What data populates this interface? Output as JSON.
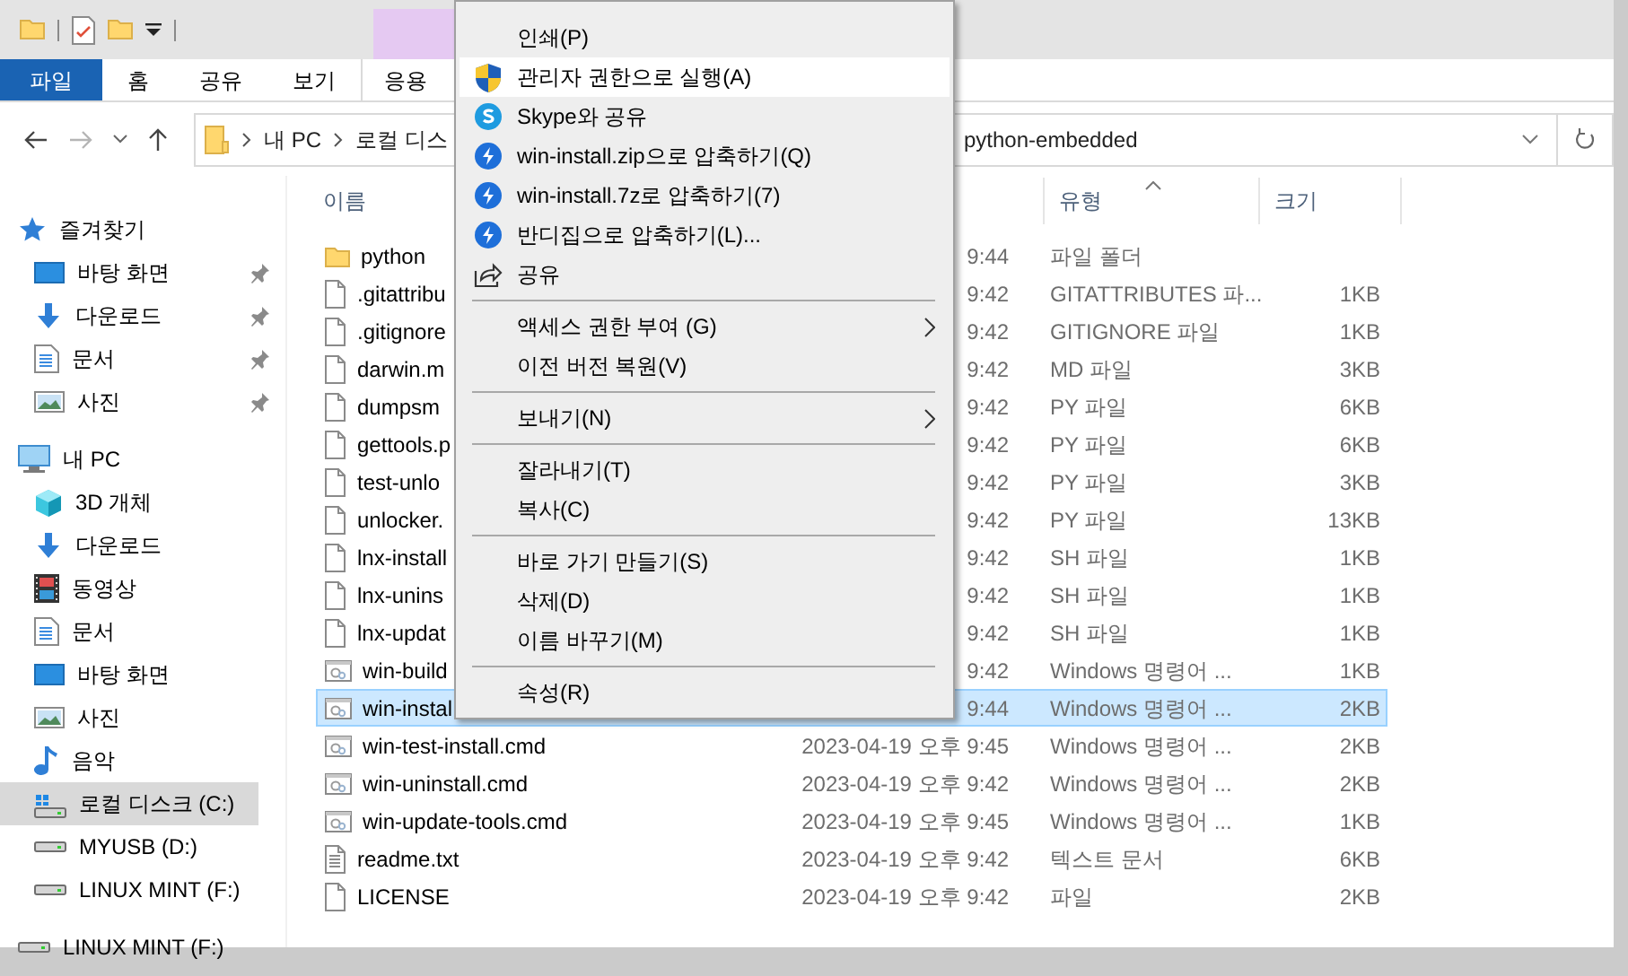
{
  "ribbon": {
    "tabs": [
      {
        "label": "파일",
        "kind": "file_menu"
      },
      {
        "label": "홈",
        "kind": "tab"
      },
      {
        "label": "공유",
        "kind": "tab"
      },
      {
        "label": "보기",
        "kind": "tab"
      },
      {
        "label": "응용",
        "kind": "contextual"
      }
    ]
  },
  "address_bar": {
    "crumbs": [
      "내 PC",
      "로컬 디스",
      "python-embedded"
    ]
  },
  "sidebar": {
    "items": [
      {
        "label": "즐겨찾기",
        "kind": "star",
        "selected": false,
        "children": [
          {
            "label": "바탕 화면",
            "kind": "desktop",
            "pinned": true,
            "selected": false
          },
          {
            "label": "다운로드",
            "kind": "download",
            "pinned": true,
            "selected": false
          },
          {
            "label": "문서",
            "kind": "document",
            "pinned": true,
            "selected": false
          },
          {
            "label": "사진",
            "kind": "pictures",
            "pinned": true,
            "selected": false
          }
        ]
      },
      {
        "label": "내 PC",
        "kind": "pc",
        "selected": false,
        "children": [
          {
            "label": "3D 개체",
            "kind": "cube",
            "pinned": false,
            "selected": false
          },
          {
            "label": "다운로드",
            "kind": "download",
            "pinned": false,
            "selected": false
          },
          {
            "label": "동영상",
            "kind": "video",
            "pinned": false,
            "selected": false
          },
          {
            "label": "문서",
            "kind": "document",
            "pinned": false,
            "selected": false
          },
          {
            "label": "바탕 화면",
            "kind": "desktop",
            "pinned": false,
            "selected": false
          },
          {
            "label": "사진",
            "kind": "pictures",
            "pinned": false,
            "selected": false
          },
          {
            "label": "음악",
            "kind": "music",
            "pinned": false,
            "selected": false
          },
          {
            "label": "로컬 디스크 (C:)",
            "kind": "system_drive",
            "pinned": false,
            "selected": true
          },
          {
            "label": "MYUSB (D:)",
            "kind": "drive",
            "pinned": false,
            "selected": false
          },
          {
            "label": "LINUX MINT (F:)",
            "kind": "drive",
            "pinned": false,
            "selected": false
          }
        ]
      },
      {
        "label": "LINUX MINT (F:)",
        "kind": "drive",
        "selected": false
      }
    ]
  },
  "file_list": {
    "columns": [
      {
        "label": "이름",
        "sorted": false
      },
      {
        "label": "유형",
        "sorted": true
      },
      {
        "label": "크기",
        "sorted": false
      }
    ],
    "rows": [
      {
        "kind": "folder",
        "name": "python",
        "date": "9:44",
        "type": "파일 폴더",
        "selected": false
      },
      {
        "kind": "file",
        "name": ".gitattribu",
        "date": "9:42",
        "type": "GITATTRIBUTES 파...",
        "size": "1KB",
        "selected": false
      },
      {
        "kind": "file",
        "name": ".gitignore",
        "date": "9:42",
        "type": "GITIGNORE 파일",
        "size": "1KB",
        "selected": false
      },
      {
        "kind": "file",
        "name": "darwin.m",
        "date": "9:42",
        "type": "MD 파일",
        "size": "3KB",
        "selected": false
      },
      {
        "kind": "file",
        "name": "dumpsm",
        "date": "9:42",
        "type": "PY 파일",
        "size": "6KB",
        "selected": false
      },
      {
        "kind": "file",
        "name": "gettools.p",
        "date": "9:42",
        "type": "PY 파일",
        "size": "6KB",
        "selected": false
      },
      {
        "kind": "file",
        "name": "test-unlo",
        "date": "9:42",
        "type": "PY 파일",
        "size": "3KB",
        "selected": false
      },
      {
        "kind": "file",
        "name": "unlocker.",
        "date": "9:42",
        "type": "PY 파일",
        "size": "13KB",
        "selected": false
      },
      {
        "kind": "file",
        "name": "lnx-install",
        "date": "9:42",
        "type": "SH 파일",
        "size": "1KB",
        "selected": false
      },
      {
        "kind": "file",
        "name": "lnx-unins",
        "date": "9:42",
        "type": "SH 파일",
        "size": "1KB",
        "selected": false
      },
      {
        "kind": "file",
        "name": "lnx-updat",
        "date": "9:42",
        "type": "SH 파일",
        "size": "1KB",
        "selected": false
      },
      {
        "kind": "script",
        "name": "win-build",
        "date": "9:42",
        "type": "Windows 명령어 ...",
        "size": "1KB",
        "selected": false
      },
      {
        "kind": "script",
        "name": "win-instal",
        "date": "9:44",
        "type": "Windows 명령어 ...",
        "size": "2KB",
        "selected": true
      },
      {
        "kind": "script",
        "name": "win-test-install.cmd",
        "date": "2023-04-19 오후 9:45",
        "type": "Windows 명령어 ...",
        "size": "2KB",
        "selected": false
      },
      {
        "kind": "script",
        "name": "win-uninstall.cmd",
        "date": "2023-04-19 오후 9:42",
        "type": "Windows 명령어 ...",
        "size": "2KB",
        "selected": false
      },
      {
        "kind": "script",
        "name": "win-update-tools.cmd",
        "date": "2023-04-19 오후 9:45",
        "type": "Windows 명령어 ...",
        "size": "1KB",
        "selected": false
      },
      {
        "kind": "text",
        "name": "readme.txt",
        "date": "2023-04-19 오후 9:42",
        "type": "텍스트 문서",
        "size": "6KB",
        "selected": false
      },
      {
        "kind": "file",
        "name": "LICENSE",
        "date": "2023-04-19 오후 9:42",
        "type": "파일",
        "size": "2KB",
        "selected": false
      }
    ]
  },
  "context_menu": {
    "items": [
      {
        "kind": "item",
        "label": "인쇄(P)",
        "highlighted": false
      },
      {
        "kind": "item",
        "label": "관리자 권한으로 실행(A)",
        "highlighted": true
      },
      {
        "kind": "item",
        "label": "Skype와 공유",
        "highlighted": false
      },
      {
        "kind": "item",
        "label": "win-install.zip으로 압축하기(Q)",
        "highlighted": false
      },
      {
        "kind": "item",
        "label": "win-install.7z로 압축하기(7)",
        "highlighted": false
      },
      {
        "kind": "item",
        "label": "반디집으로 압축하기(L)...",
        "highlighted": false
      },
      {
        "kind": "item",
        "label": "공유",
        "highlighted": false
      },
      {
        "kind": "separator"
      },
      {
        "kind": "submenu",
        "label": "액세스 권한 부여 (G)",
        "highlighted": false
      },
      {
        "kind": "item",
        "label": "이전 버전 복원(V)",
        "highlighted": false
      },
      {
        "kind": "separator"
      },
      {
        "kind": "submenu",
        "label": "보내기(N)",
        "highlighted": false
      },
      {
        "kind": "separator"
      },
      {
        "kind": "item",
        "label": "잘라내기(T)",
        "highlighted": false
      },
      {
        "kind": "item",
        "label": "복사(C)",
        "highlighted": false
      },
      {
        "kind": "separator"
      },
      {
        "kind": "item",
        "label": "바로 가기 만들기(S)",
        "highlighted": false
      },
      {
        "kind": "item",
        "label": "삭제(D)",
        "highlighted": false
      },
      {
        "kind": "item",
        "label": "이름 바꾸기(M)",
        "highlighted": false
      },
      {
        "kind": "separator"
      },
      {
        "kind": "item",
        "label": "속성(R)",
        "highlighted": false
      }
    ]
  }
}
